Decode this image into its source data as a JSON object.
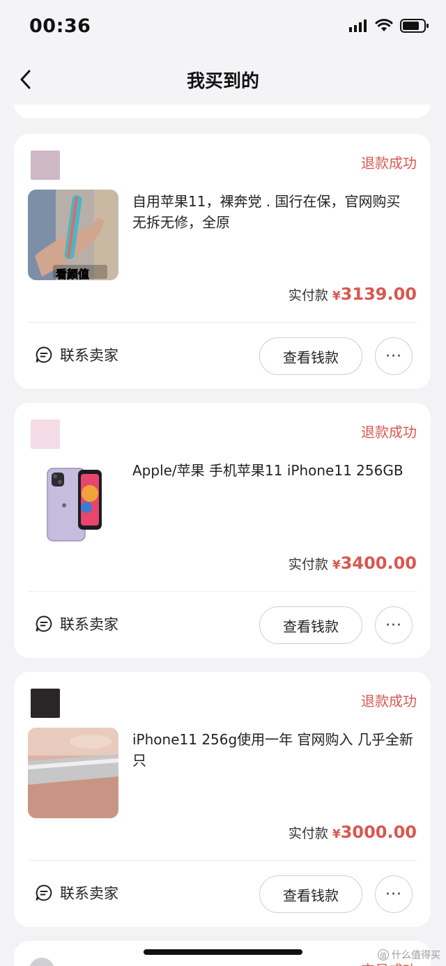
{
  "status_bar": {
    "time": "00:36"
  },
  "nav": {
    "title": "我买到的"
  },
  "orders": [
    {
      "status": "退款成功",
      "title": "自用苹果11，裸奔党 . 国行在保，官网购买 无拆无修，全原",
      "thumb_caption": "看颜值",
      "price_label": "实付款",
      "currency": "¥",
      "price": "3139.00",
      "contact_label": "联系卖家",
      "view_label": "查看钱款",
      "more_label": "···"
    },
    {
      "status": "退款成功",
      "title": "Apple/苹果 手机苹果11 iPhone11 256GB",
      "price_label": "实付款",
      "currency": "¥",
      "price": "3400.00",
      "contact_label": "联系卖家",
      "view_label": "查看钱款",
      "more_label": "···"
    },
    {
      "status": "退款成功",
      "title": "iPhone11 256g使用一年 官网购入  几乎全新 只",
      "price_label": "实付款",
      "currency": "¥",
      "price": "3000.00",
      "contact_label": "联系卖家",
      "view_label": "查看钱款",
      "more_label": "···"
    }
  ],
  "partial_next": {
    "status": "交易成功"
  },
  "watermark": {
    "badge": "值",
    "text": "什么值得买"
  },
  "colors": {
    "accent": "#d9574f",
    "background": "#f3f3f5",
    "card": "#ffffff"
  }
}
